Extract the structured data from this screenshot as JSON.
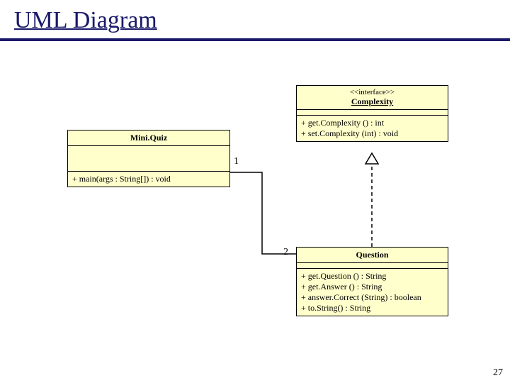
{
  "title": "UML Diagram",
  "slide_number": "27",
  "complexity": {
    "stereotype": "<<interface>>",
    "name": "Complexity",
    "methods": [
      "+ get.Complexity () : int",
      "+ set.Complexity (int) : void"
    ]
  },
  "miniquiz": {
    "name": "Mini.Quiz",
    "methods": [
      "+ main(args : String[]) : void"
    ]
  },
  "question": {
    "name": "Question",
    "methods": [
      "+ get.Question () : String",
      "+ get.Answer () : String",
      "+ answer.Correct (String) : boolean",
      "+ to.String() : String"
    ]
  },
  "multiplicity": {
    "one": "1",
    "two": "2"
  }
}
